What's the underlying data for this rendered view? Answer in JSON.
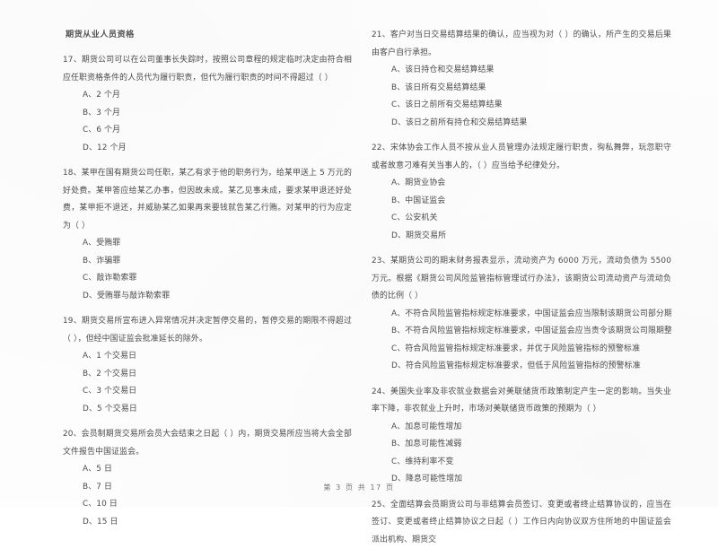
{
  "document": {
    "header": "期货从业人员资格",
    "footer": "第 3 页 共 17 页",
    "page_number": "3",
    "total_pages": "17"
  },
  "columns": {
    "left": {
      "questions": [
        {
          "number": "17",
          "stem": "17、期货公司可以在公司董事长失踪时，按照公司章程的规定临时决定由符合相应任职资格条件的人员代为履行职责，但代为履行职责的时间不得超过（        ）",
          "options": [
            "A、2 个月",
            "B、3 个月",
            "C、6 个月",
            "D、12 个月"
          ]
        },
        {
          "number": "18",
          "stem": "18、某甲在国有期货公司任职，某乙有求于他的职务行为，给某甲送上 5 万元的好处费。某甲答应给某乙办事，但因故未成。某乙见事未成，要求某甲退还好处费，某甲拒不退还，并威胁某乙如果再来要钱就告某乙行贿。对某甲的行为应定为（        ）",
          "options": [
            "A、受贿罪",
            "B、诈骗罪",
            "C、敲诈勒索罪",
            "D、受贿罪与敲诈勒索罪"
          ]
        },
        {
          "number": "19",
          "stem": "19、期货交易所宣布进入异常情况并决定暂停交易的，暂停交易的期限不得超过（        ），但经中国证监会批准延长的除外。",
          "options": [
            "A、1 个交易日",
            "B、2 个交易日",
            "C、3 个交易日",
            "D、5 个交易日"
          ]
        },
        {
          "number": "20",
          "stem": "20、会员制期货交易所会员大会结束之日起（        ）内，期货交易所应当将大会全部文件报告中国证监会。",
          "options": [
            "A、5 日",
            "B、7 日",
            "C、10 日",
            "D、15 日"
          ]
        }
      ]
    },
    "right": {
      "questions": [
        {
          "number": "21",
          "stem": "21、客户对当日交易结算结果的确认，应当视为对（        ）的确认，所产生的交易后果由客户自行承担。",
          "options": [
            "A、该日持仓和交易结算结果",
            "B、该日所有交易结算结果",
            "C、该日之前所有交易结算结果",
            "D、该日之前所有持仓和交易结算结果"
          ]
        },
        {
          "number": "22",
          "stem": "22、宋体协会工作人员不按从业人员管理办法规定履行职责，徇私舞弊，玩忽职守或者故意刁难有关当事人的，（        ）应当给予纪律处分。",
          "options": [
            "A、期货业协会",
            "B、中国证监会",
            "C、公安机关",
            "D、期货交易所"
          ]
        },
        {
          "number": "23",
          "stem": "23、某期货公司的期末财务报表显示，流动资产为 6000 万元，流动负债为 5500 万元。根据《期货公司风险监管指标管理试行办法》，该期货公司流动资产与流动负债的比例（        ）",
          "options": [
            "A、不符合风险监管指标规定标准要求，中国证监会应当限制该期货公司部分期货业务",
            "B、不符合风险监管指标规定标准要求，中国证监会应当责令该期货公司限期整改",
            "C、符合风险监管指标规定标准要求，并优于风险监管指标的预警标准",
            "D、符合风险监管指标规定标准要求，但低于风险监管指标的预警标准"
          ]
        },
        {
          "number": "24",
          "stem": "24、美国失业率及非农就业数据会对美联储货币政策制定产生一定的影响。当失业率下降，非农就业上升时，市场对美联储货币政策的预期为（        ）",
          "options": [
            "A、加息可能性增加",
            "B、加息可能性减弱",
            "C、维持利率不变",
            "D、降息可能性增加"
          ]
        },
        {
          "number": "25",
          "stem": "25、全面结算会员期货公司与非结算会员签订、变更或者终止结算协议的，应当在签订、变更或者终止结算协议之日起（        ）工作日内向协议双方住所地的中国证监会派出机构、期货交",
          "options": []
        }
      ]
    }
  }
}
